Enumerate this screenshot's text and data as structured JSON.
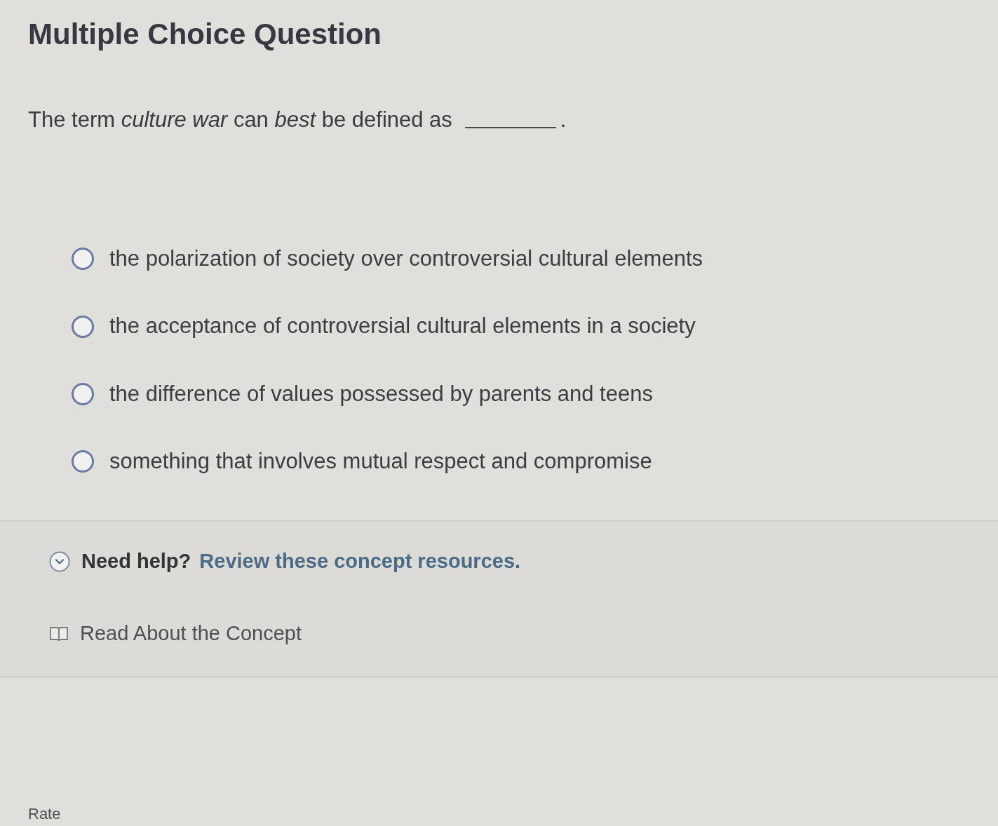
{
  "title": "Multiple Choice Question",
  "question": {
    "text": "The term *culture war* can *best* be defined as",
    "after_blank": "."
  },
  "options": [
    {
      "text": "the polarization of society over controversial cultural elements",
      "selected": false
    },
    {
      "text": "the acceptance of controversial cultural elements in a society",
      "selected": false
    },
    {
      "text": "the difference of values possessed by parents and teens",
      "selected": false
    },
    {
      "text": "something that involves mutual respect and compromise",
      "selected": false
    }
  ],
  "help": {
    "expanded": true,
    "heading": "Need help?",
    "link": "Review these concept resources.",
    "resources": [
      {
        "kind": "reading",
        "label": "Read About the Concept"
      }
    ]
  },
  "footer": {
    "rate_label": "Rate"
  }
}
